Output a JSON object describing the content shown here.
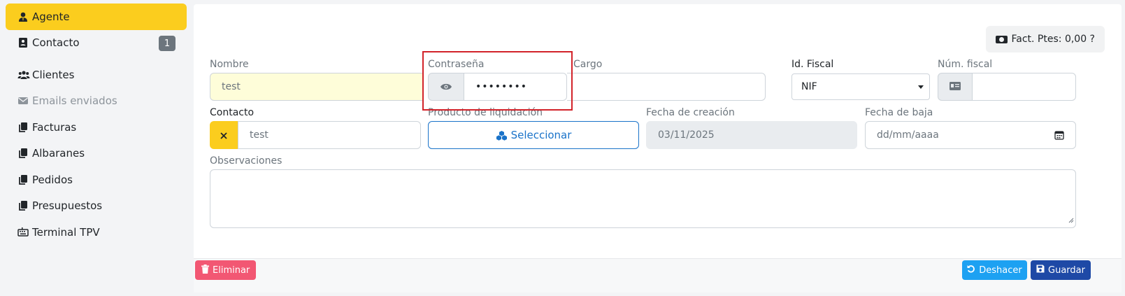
{
  "sidebar": {
    "items": [
      {
        "label": "Agente",
        "icon": "user-tie-icon",
        "active": true
      },
      {
        "label": "Contacto",
        "icon": "address-card-icon",
        "badge": "1"
      },
      {
        "label": "Clientes",
        "icon": "users-icon"
      },
      {
        "label": "Emails enviados",
        "icon": "envelope-icon",
        "disabled": true
      },
      {
        "label": "Facturas",
        "icon": "copy-icon"
      },
      {
        "label": "Albaranes",
        "icon": "copy-icon"
      },
      {
        "label": "Pedidos",
        "icon": "copy-icon"
      },
      {
        "label": "Presupuestos",
        "icon": "copy-icon"
      },
      {
        "label": "Terminal TPV",
        "icon": "keyboard-icon"
      }
    ]
  },
  "header": {
    "fact_pending": "Fact. Ptes: 0,00 ?"
  },
  "form": {
    "nombre": {
      "label": "Nombre",
      "value": "test"
    },
    "contrasena": {
      "label": "Contraseña",
      "value": "••••••••"
    },
    "cargo": {
      "label": "Cargo",
      "value": ""
    },
    "id_fiscal": {
      "label": "Id. Fiscal",
      "value": "NIF"
    },
    "num_fiscal": {
      "label": "Núm. fiscal",
      "value": ""
    },
    "contacto": {
      "label": "Contacto",
      "value": "test"
    },
    "producto": {
      "label": "Producto de liquidación",
      "button": "Seleccionar"
    },
    "fecha_creacion": {
      "label": "Fecha de creación",
      "value": "03/11/2025"
    },
    "fecha_baja": {
      "label": "Fecha de baja",
      "placeholder": "dd/mm/aaaa"
    },
    "observaciones": {
      "label": "Observaciones",
      "value": ""
    }
  },
  "footer": {
    "delete": "Eliminar",
    "undo": "Deshacer",
    "save": "Guardar"
  },
  "colors": {
    "accent": "#fbcd1e",
    "danger": "#f25773",
    "info": "#1da1f2",
    "primary": "#1e49a6",
    "highlight": "#d2232a"
  }
}
